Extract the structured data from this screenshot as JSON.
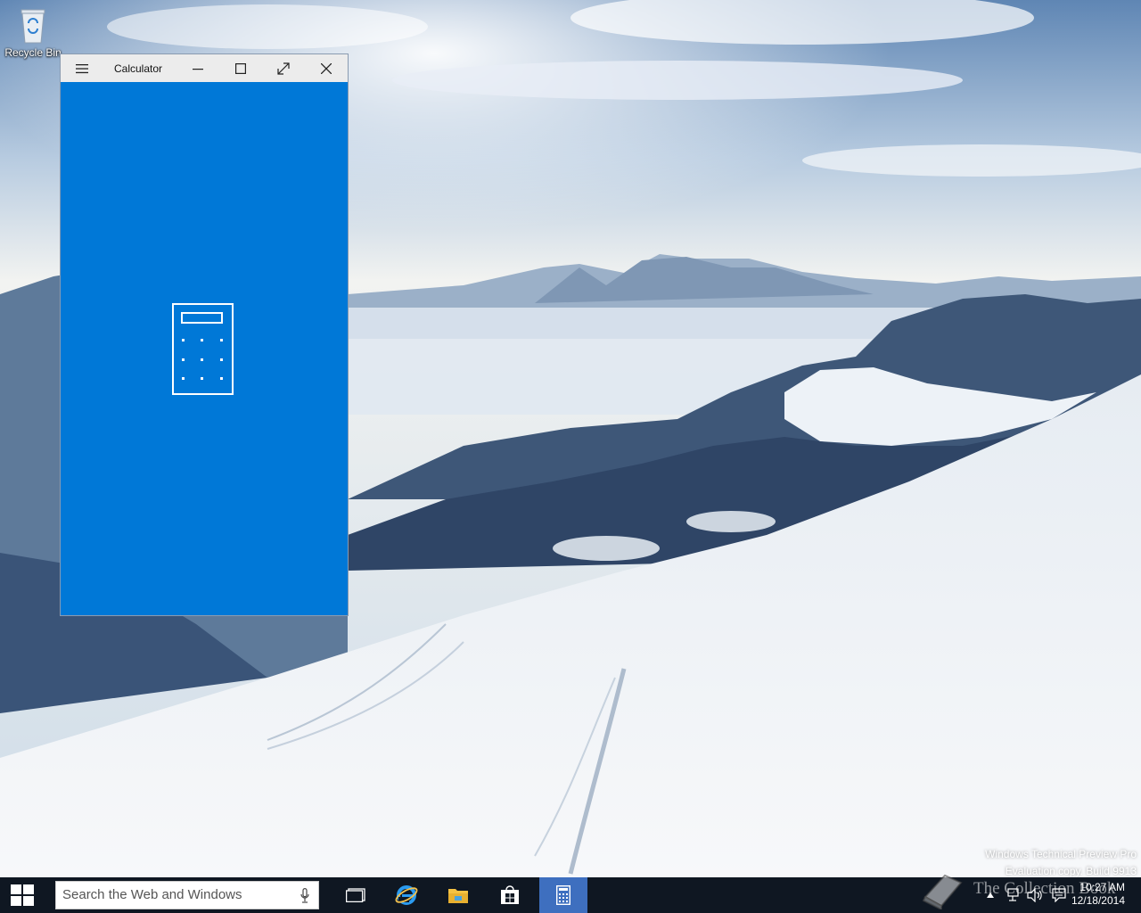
{
  "desktop": {
    "recycle_bin_label": "Recycle Bin",
    "watermark_line1": "Windows Technical Preview Pro",
    "watermark_line2": "Evaluation copy. Build 9913"
  },
  "calculator_window": {
    "title": "Calculator",
    "menu_icon": "hamburger-icon",
    "controls": [
      "minimize-icon",
      "maximize-icon",
      "fullscreen-icon",
      "close-icon"
    ],
    "splash_icon": "calculator-icon",
    "accent_color": "#0078d7"
  },
  "taskbar": {
    "search_placeholder": "Search the Web and Windows",
    "pinned": [
      "task-view-icon",
      "internet-explorer-icon",
      "file-explorer-icon",
      "store-icon",
      "calculator-icon"
    ],
    "active_app": "calculator-icon",
    "time": "10:27 AM",
    "date": "12/18/2014"
  },
  "branding": {
    "overlay_text": "The Collection Book"
  }
}
